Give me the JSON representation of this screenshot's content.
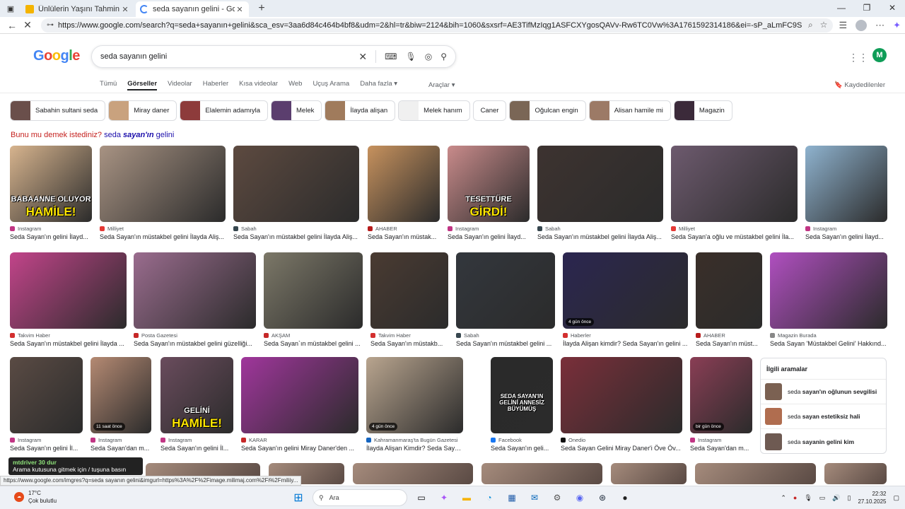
{
  "browser": {
    "tabs": [
      {
        "title": "Ünlülerin Yaşını Tahmin Et! - Quiz",
        "favicon_color": "#f4b400",
        "active": false
      },
      {
        "title": "seda sayanın gelini - Google'da A",
        "favicon_color": "#4285f4",
        "active": true
      }
    ],
    "new_tab": "+",
    "url": "https://www.google.com/search?q=seda+sayanın+gelini&sca_esv=3aa6d84c464b4bf8&udm=2&hl=tr&biw=2124&bih=1060&sxsrf=AE3TifMzIqg1ASFCXYgosQAVv-Rw6TC0Vw%3A1761592314186&ei=-sP_aLmFC9SF7NYP1eOqsQM&ved=0ahUKEwi56oD..."
  },
  "google": {
    "logo": {
      "letters": [
        "G",
        "o",
        "o",
        "g",
        "l",
        "e"
      ]
    },
    "search_value": "seda sayanın gelini",
    "account_initial": "M",
    "tabs": [
      {
        "label": "Tümü",
        "active": false
      },
      {
        "label": "Görseller",
        "active": true
      },
      {
        "label": "Videolar",
        "active": false
      },
      {
        "label": "Haberler",
        "active": false
      },
      {
        "label": "Kısa videolar",
        "active": false
      },
      {
        "label": "Web",
        "active": false
      },
      {
        "label": "Uçuş Arama",
        "active": false
      },
      {
        "label": "Daha fazla ▾",
        "active": false
      }
    ],
    "tools_label": "Araçlar ▾",
    "saved_label": "Kaydedilenler"
  },
  "chips": [
    {
      "label": "Sabahin sultani seda",
      "thumb": "#6a4f4b"
    },
    {
      "label": "Miray daner",
      "thumb": "#c9a27e"
    },
    {
      "label": "Elalemin adamıyla",
      "thumb": "#8d3b3b"
    },
    {
      "label": "Melek",
      "thumb": "#5b3e6e"
    },
    {
      "label": "İlayda alişan",
      "thumb": "#a07b5c"
    },
    {
      "label": "Melek hanım",
      "thumb": "#f0f0f0"
    },
    {
      "label": "Caner",
      "thumb": ""
    },
    {
      "label": "Oğulcan engin",
      "thumb": "#7a6656"
    },
    {
      "label": "Alisan hamile mi",
      "thumb": "#9c7a66"
    },
    {
      "label": "Magazin",
      "thumb": "#3b2a3a"
    }
  ],
  "did_you_mean": {
    "prefix": "Bunu mu demek istediniz?",
    "query_start": "seda ",
    "query_bold": "sayan'ın",
    "query_end": " gelini"
  },
  "results": [
    {
      "source": "Instagram",
      "caption": "Seda Sayan'ın gelini İlayd...",
      "color": "#d7b48e",
      "overlay": "BABAANNE OLUYOR",
      "overlay2": "HAMİLE!",
      "fav": "#c13584"
    },
    {
      "source": "Milliyet",
      "caption": "Seda Sayan'ın müstakbel gelini İlayda Aliş...",
      "color": "#a89383",
      "fav": "#e53935"
    },
    {
      "source": "Sabah",
      "caption": "Seda Sayan'ın müstakbel gelini İlayda Aliş...",
      "color": "#5d4a40",
      "fav": "#37474f"
    },
    {
      "source": "AHABER",
      "caption": "Seda Sayan'ın müstak...",
      "color": "#c7925e",
      "fav": "#b71c1c"
    },
    {
      "source": "Instagram",
      "caption": "Seda Sayan'ın gelini İlayd...",
      "color": "#c98b8b",
      "overlay": "TESETTÜRE",
      "overlay2": "GİRDİ!",
      "fav": "#c13584"
    },
    {
      "source": "Sabah",
      "caption": "Seda Sayan'ın müstakbel gelini İlayda Aliş...",
      "color": "#3d3330",
      "fav": "#37474f"
    },
    {
      "source": "Milliyet",
      "caption": "Seda Sayan'a oğlu ve müstakbel gelini İla...",
      "color": "#6d5a6e",
      "fav": "#e53935"
    },
    {
      "source": "Instagram",
      "caption": "Seda Sayan'ın gelini İlayd...",
      "color": "#8fb3cf",
      "fav": "#c13584"
    },
    {
      "source": "Takvim Haber",
      "caption": "Seda Sayan'ın müstakbel gelini İlayda ...",
      "color": "#c2448a",
      "fav": "#d32f2f"
    },
    {
      "source": "Posta Gazetesi",
      "caption": "Seda Sayan'ın müstakbel gelini güzelliği...",
      "color": "#9a6c8e",
      "fav": "#c62828"
    },
    {
      "source": "AKŞAM",
      "caption": "Seda Sayan`ın müstakbel gelini ...",
      "color": "#7c7868",
      "fav": "#c62828"
    },
    {
      "source": "Takvim Haber",
      "caption": "Seda Sayan'ın müstakb...",
      "color": "#4a3b32",
      "fav": "#d32f2f"
    },
    {
      "source": "Sabah",
      "caption": "Seda Sayan'ın müstakbel gelini ...",
      "color": "#33373d",
      "fav": "#37474f"
    },
    {
      "source": "Haberler",
      "caption": "İlayda Alişan kimdir? Seda Sayan'ın gelini ...",
      "color": "#2b2650",
      "badge": "4 gün önce",
      "fav": "#d32f2f"
    },
    {
      "source": "AHABER",
      "caption": "Seda Sayan'ın müst...",
      "color": "#3a2f29",
      "fav": "#b71c1c"
    },
    {
      "source": "Magazin Burada",
      "caption": "Seda Sayan 'Müstakbel Gelini' Hakkınd...",
      "color": "#b04fc0",
      "fav": "#888888"
    },
    {
      "source": "Instagram",
      "caption": "Seda Sayan'ın gelini İl...",
      "color": "#5a4b44",
      "fav": "#c13584"
    },
    {
      "source": "Instagram",
      "caption": "Seda Sayan'dan m...",
      "color": "#b58a73",
      "badge": "11 saat önce",
      "fav": "#c13584"
    },
    {
      "source": "Instagram",
      "caption": "Seda Sayan'ın gelini İl...",
      "color": "#6a4c5d",
      "overlay": "GELİNİ",
      "overlay2": "HAMİLE!",
      "fav": "#c13584"
    },
    {
      "source": "KARAR",
      "caption": "Seda Sayan'ın gelini Miray Daner'den ...",
      "color": "#a0369c",
      "fav": "#c62828"
    },
    {
      "source": "Kahramanmaraş'ta Bugün Gazetesi",
      "caption": "İlayda Alişan Kimdir? Seda Sayan'ın Ge...",
      "color": "#b9a58f",
      "badge": "4 gün önce",
      "fav": "#1565c0"
    },
    {
      "source": "Facebook",
      "caption": "Seda Sayan'ın geli...",
      "color": "#2a2a2a",
      "overlay": "SEDA SAYAN'IN GELİNİ ANNESİZ BÜYÜMÜŞ",
      "fav": "#1877f2"
    },
    {
      "source": "Onedio",
      "caption": "Seda Sayan Gelini Miray Daner'i Öve Öv...",
      "color": "#7a2f3a",
      "fav": "#111111"
    },
    {
      "source": "Instagram",
      "caption": "Seda Sayan'dan m...",
      "color": "#8a3e55",
      "badge": "bir gün önce",
      "fav": "#c13584"
    }
  ],
  "related": {
    "title": "İlgili aramalar",
    "items": [
      {
        "prefix": "seda ",
        "bold": "sayan'ın oğlunun sevgilisi",
        "thumb": "#7b6152"
      },
      {
        "prefix": "seda ",
        "bold": "sayan estetiksiz hali",
        "thumb": "#b06d4f"
      },
      {
        "prefix": "seda ",
        "bold": "sayanin gelini kim",
        "thumb": "#6e5a52"
      }
    ]
  },
  "status_url": "https://www.google.com/imgres?q=seda sayanın gelini&imgurl=https%3A%2F%2Fimage.milimaj.com%2Fi%2Fmiliiy...",
  "game_overlay": {
    "line1": "mtdriver 30 dur",
    "line2": "Arama kutusuna gitmek için / tuşuna basın"
  },
  "taskbar": {
    "weather_temp": "17°C",
    "weather_desc": "Çok bulutlu",
    "search_label": "Ara",
    "time": "22:32",
    "date": "27.10.2025"
  }
}
